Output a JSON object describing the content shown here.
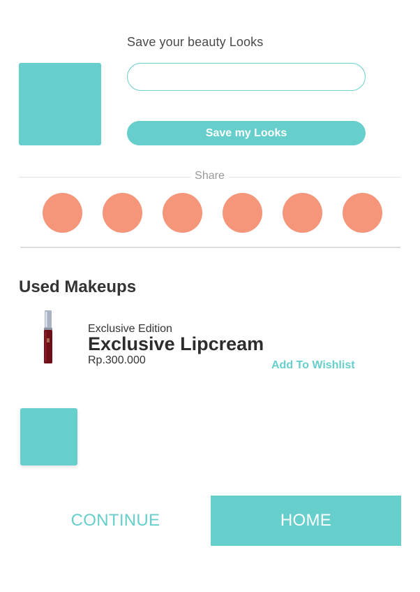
{
  "save_section": {
    "heading": "Save your beauty Looks",
    "input_value": "",
    "input_placeholder": "",
    "save_button_label": "Save my Looks"
  },
  "share": {
    "label": "Share",
    "buttons": [
      "share-option-1",
      "share-option-2",
      "share-option-3",
      "share-option-4",
      "share-option-5",
      "share-option-6"
    ]
  },
  "used_makeups": {
    "heading": "Used Makeups",
    "items": [
      {
        "edition": "Exclusive Edition",
        "name": "Exclusive Lipcream",
        "price": "Rp.300.000",
        "wishlist_label": "Add To Wishlist"
      }
    ]
  },
  "footer": {
    "continue_label": "CONTINUE",
    "home_label": "HOME"
  },
  "colors": {
    "accent": "#66cecb",
    "share_button": "#f5967a",
    "lipcream": "#6e0f18"
  }
}
